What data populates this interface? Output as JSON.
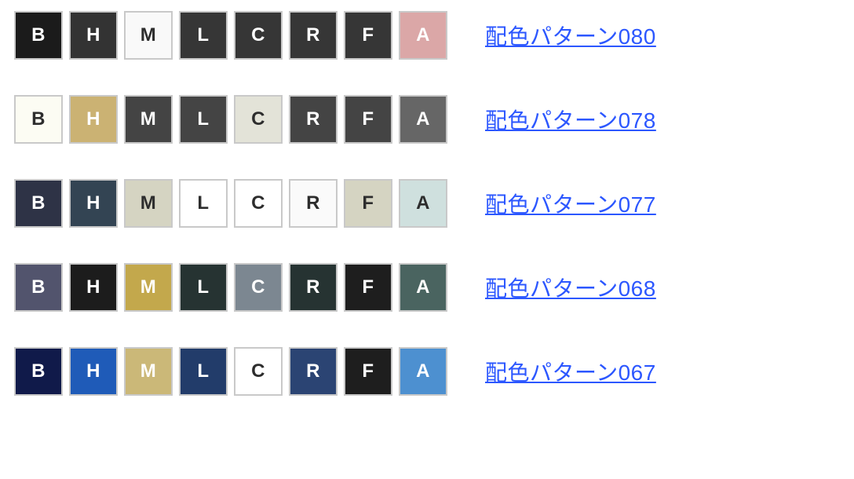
{
  "swatch_letters": [
    "B",
    "H",
    "M",
    "L",
    "C",
    "R",
    "F",
    "A"
  ],
  "rows": [
    {
      "link_label": "配色パターン080",
      "swatches": [
        {
          "bg": "#1b1b1b",
          "fg": "#ffffff"
        },
        {
          "bg": "#333333",
          "fg": "#ffffff"
        },
        {
          "bg": "#f9f9f9",
          "fg": "#2d2d2d"
        },
        {
          "bg": "#363636",
          "fg": "#ffffff"
        },
        {
          "bg": "#363636",
          "fg": "#ffffff"
        },
        {
          "bg": "#363636",
          "fg": "#ffffff"
        },
        {
          "bg": "#363636",
          "fg": "#ffffff"
        },
        {
          "bg": "#dba7a7",
          "fg": "#ffffff"
        }
      ]
    },
    {
      "link_label": "配色パターン078",
      "swatches": [
        {
          "bg": "#fcfcf3",
          "fg": "#2d2d2d"
        },
        {
          "bg": "#cbb273",
          "fg": "#ffffff"
        },
        {
          "bg": "#444444",
          "fg": "#ffffff"
        },
        {
          "bg": "#444444",
          "fg": "#ffffff"
        },
        {
          "bg": "#e3e3d8",
          "fg": "#2d2d2d"
        },
        {
          "bg": "#444444",
          "fg": "#ffffff"
        },
        {
          "bg": "#444444",
          "fg": "#ffffff"
        },
        {
          "bg": "#666666",
          "fg": "#ffffff"
        }
      ]
    },
    {
      "link_label": "配色パターン077",
      "swatches": [
        {
          "bg": "#2e3346",
          "fg": "#ffffff"
        },
        {
          "bg": "#334453",
          "fg": "#ffffff"
        },
        {
          "bg": "#d5d4c2",
          "fg": "#2d2d2d"
        },
        {
          "bg": "#ffffff",
          "fg": "#2d2d2d"
        },
        {
          "bg": "#ffffff",
          "fg": "#2d2d2d"
        },
        {
          "bg": "#fafafa",
          "fg": "#2d2d2d"
        },
        {
          "bg": "#d5d4c2",
          "fg": "#2d2d2d"
        },
        {
          "bg": "#cfe0de",
          "fg": "#2d2d2d"
        }
      ]
    },
    {
      "link_label": "配色パターン068",
      "swatches": [
        {
          "bg": "#52546d",
          "fg": "#ffffff"
        },
        {
          "bg": "#1c1c1c",
          "fg": "#ffffff"
        },
        {
          "bg": "#c3a84c",
          "fg": "#ffffff"
        },
        {
          "bg": "#263332",
          "fg": "#ffffff"
        },
        {
          "bg": "#7c8791",
          "fg": "#ffffff"
        },
        {
          "bg": "#263332",
          "fg": "#ffffff"
        },
        {
          "bg": "#1e1e1e",
          "fg": "#ffffff"
        },
        {
          "bg": "#4a6460",
          "fg": "#ffffff"
        }
      ]
    },
    {
      "link_label": "配色パターン067",
      "swatches": [
        {
          "bg": "#101a4a",
          "fg": "#ffffff"
        },
        {
          "bg": "#1f5bb8",
          "fg": "#ffffff"
        },
        {
          "bg": "#cbb878",
          "fg": "#ffffff"
        },
        {
          "bg": "#223c6a",
          "fg": "#ffffff"
        },
        {
          "bg": "#ffffff",
          "fg": "#2d2d2d"
        },
        {
          "bg": "#2b4473",
          "fg": "#ffffff"
        },
        {
          "bg": "#1e1e1e",
          "fg": "#ffffff"
        },
        {
          "bg": "#4d90d0",
          "fg": "#ffffff"
        }
      ]
    }
  ]
}
